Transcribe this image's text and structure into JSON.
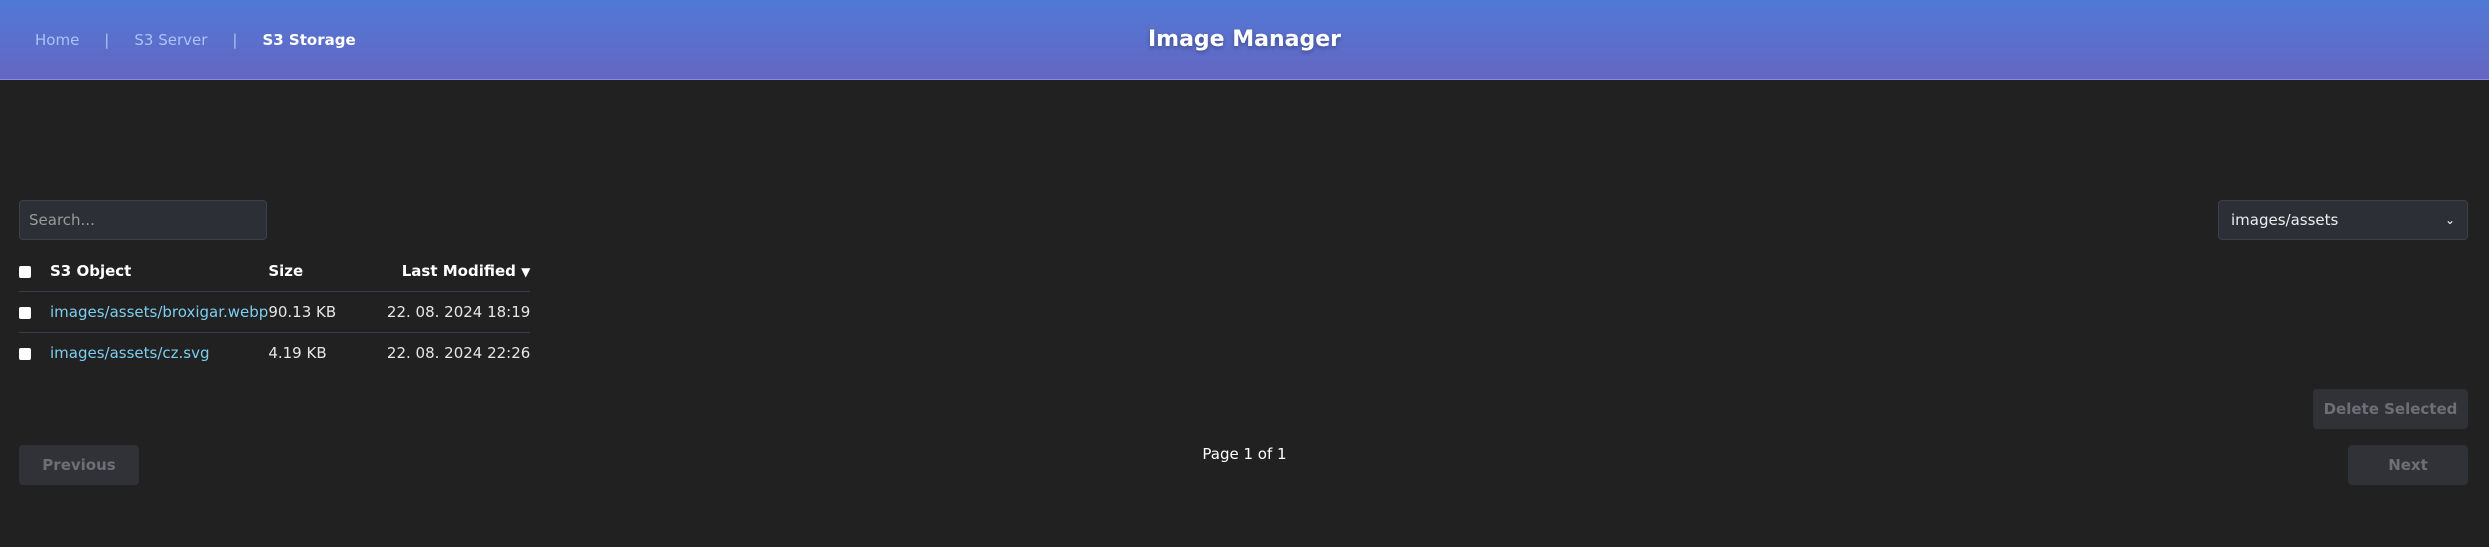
{
  "header": {
    "title": "Image Manager",
    "nav": [
      {
        "label": "Home",
        "active": false
      },
      {
        "label": "S3 Server",
        "active": false
      },
      {
        "label": "S3 Storage",
        "active": true
      }
    ],
    "separator": "|"
  },
  "search": {
    "placeholder": "Search...",
    "value": ""
  },
  "folder_select": {
    "selected": "images/assets"
  },
  "table": {
    "columns": {
      "object": "S3 Object",
      "size": "Size",
      "modified": "Last Modified",
      "sort_indicator": "▼"
    },
    "rows": [
      {
        "name": "images/assets/broxigar.webp",
        "size": "90.13 KB",
        "modified": "22. 08. 2024 18:19"
      },
      {
        "name": "images/assets/cz.svg",
        "size": "4.19 KB",
        "modified": "22. 08. 2024 22:26"
      }
    ]
  },
  "actions": {
    "delete_selected": "Delete Selected"
  },
  "pagination": {
    "previous": "Previous",
    "next": "Next",
    "status": "Page 1 of 1"
  }
}
